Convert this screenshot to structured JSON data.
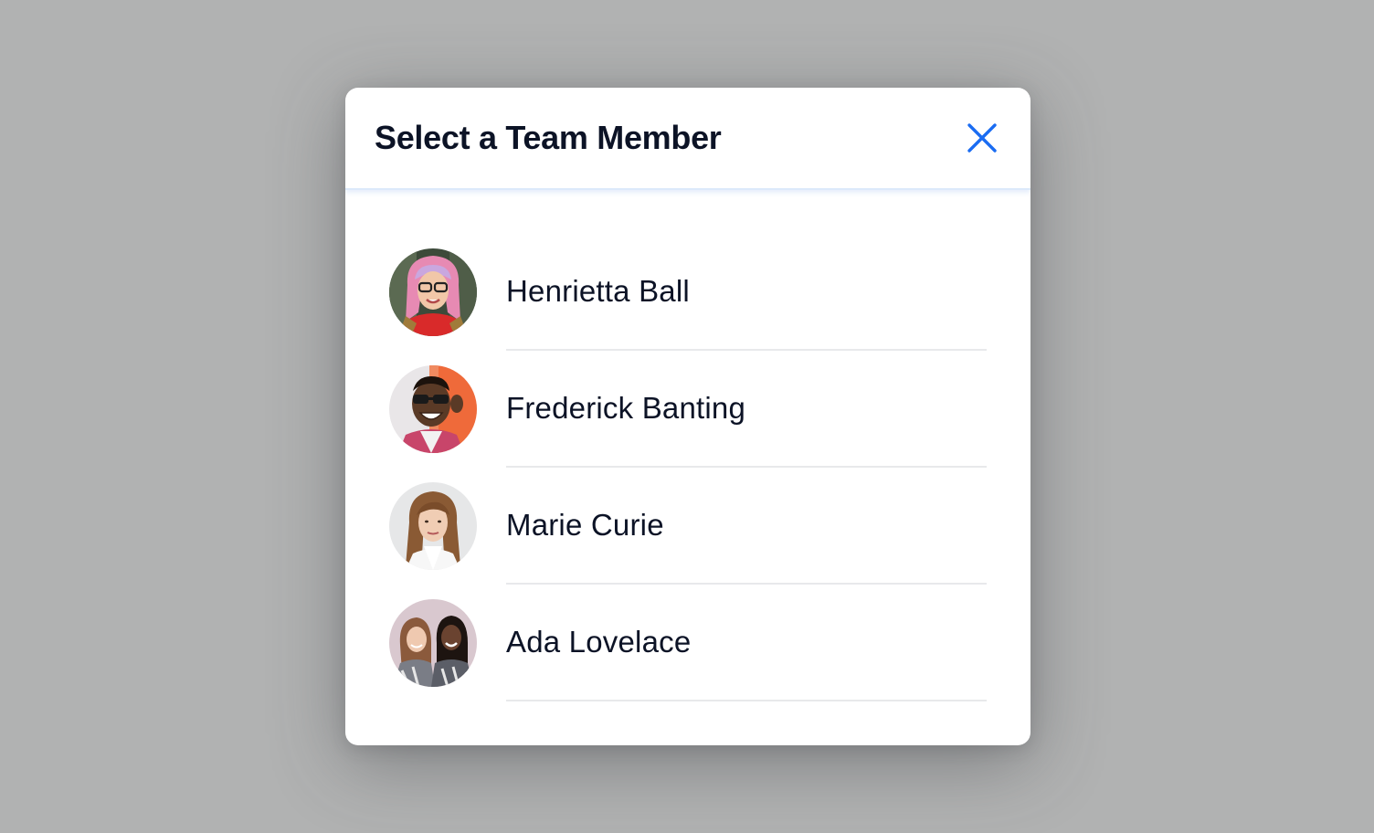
{
  "modal": {
    "title": "Select a Team Member",
    "close_icon": "close-icon",
    "accent_color": "#1a6cf2"
  },
  "members": [
    {
      "name": "Henrietta Ball",
      "avatar": "avatar-photo"
    },
    {
      "name": "Frederick Banting",
      "avatar": "avatar-photo"
    },
    {
      "name": "Marie Curie",
      "avatar": "avatar-photo"
    },
    {
      "name": "Ada Lovelace",
      "avatar": "avatar-photo"
    }
  ]
}
